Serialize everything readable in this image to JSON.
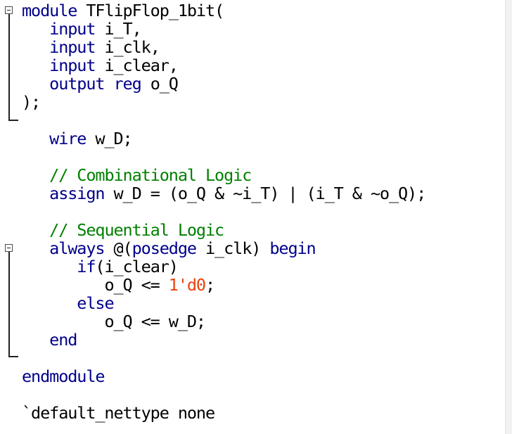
{
  "code": {
    "line1": {
      "kw": "module",
      "rest": " TFlipFlop_1bit("
    },
    "line2": {
      "kw": "input",
      "rest": " i_T,"
    },
    "line3": {
      "kw": "input",
      "rest": " i_clk,"
    },
    "line4": {
      "kw": "input",
      "rest": " i_clear,"
    },
    "line5": {
      "kw": "output reg",
      "rest": " o_Q"
    },
    "line6": ");",
    "line8": {
      "kw": "wire",
      "rest": " w_D;"
    },
    "line10": "// Combinational Logic",
    "line11": {
      "kw": "assign",
      "rest": " w_D = (o_Q & ~i_T) | (i_T & ~o_Q);"
    },
    "line13": "// Sequential Logic",
    "line14": {
      "kw1": "always",
      "mid": " @(",
      "kw2": "posedge",
      "mid2": " i_clk) ",
      "kw3": "begin"
    },
    "line15": {
      "kw": "if",
      "rest": "(i_clear)"
    },
    "line16": {
      "pre": "o_Q <= ",
      "num": "1'd0",
      "post": ";"
    },
    "line17": {
      "kw": "else"
    },
    "line18": "o_Q <= w_D;",
    "line19": {
      "kw": "end"
    },
    "line21": {
      "kw": "endmodule"
    },
    "line23": "`default_nettype none"
  },
  "colors": {
    "keyword": "#00008b",
    "comment": "#008000",
    "number": "#e8420c",
    "text": "#000000"
  },
  "gutter": {
    "fold_marker_icon": "minus-box-icon"
  }
}
